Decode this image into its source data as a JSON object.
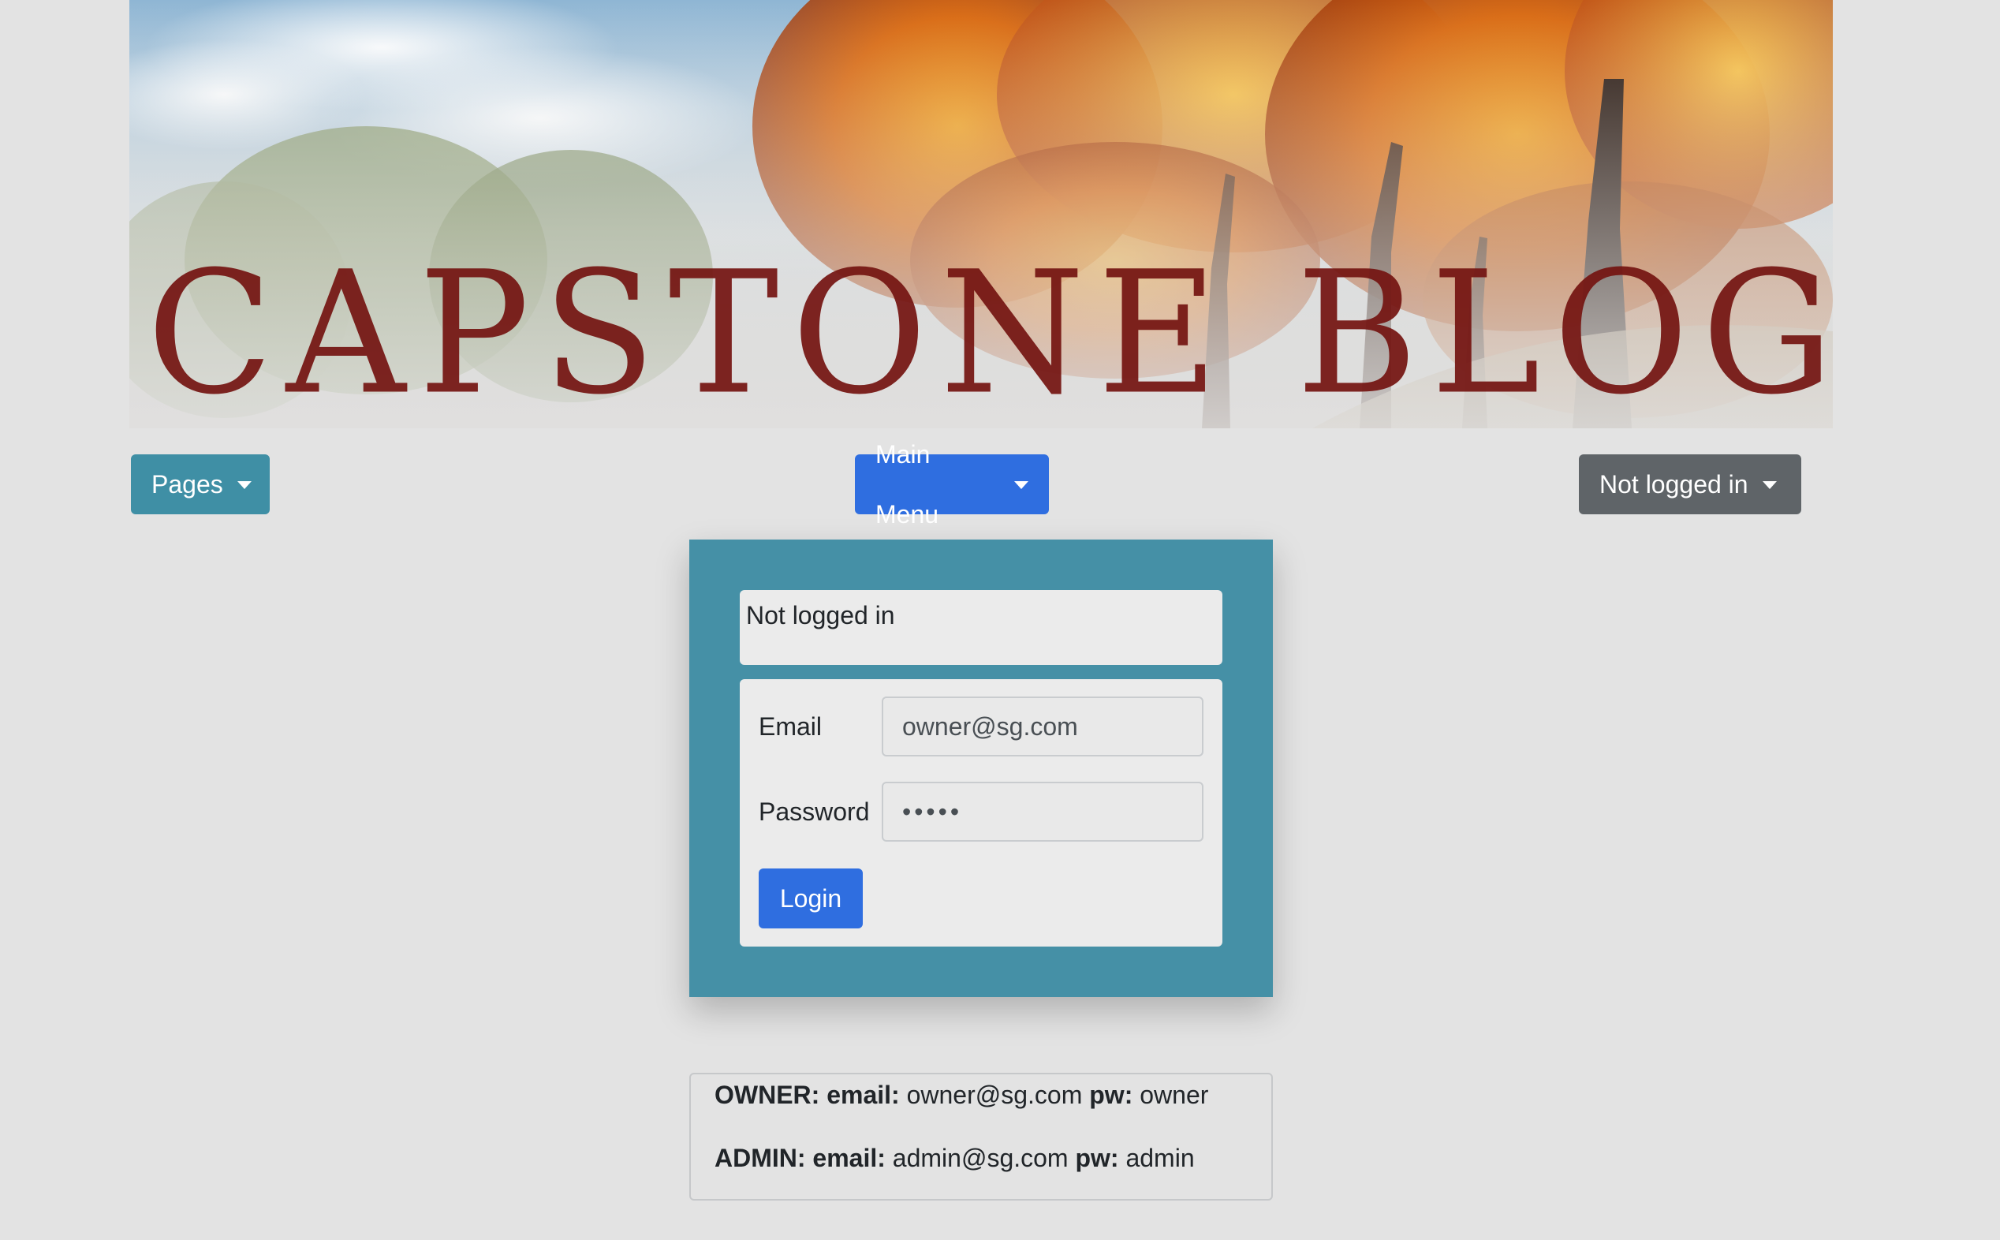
{
  "banner": {
    "title": "CAPSTONE BLOG"
  },
  "nav": {
    "pages_label": "Pages",
    "main_menu_label": "Main Menu",
    "user_menu_label": "Not logged in"
  },
  "login": {
    "status_text": "Not logged in",
    "email_label": "Email",
    "email_value": "owner@sg.com",
    "password_label": "Password",
    "password_value": "•••••",
    "login_button": "Login"
  },
  "credentials": {
    "owner": {
      "role": "OWNER:",
      "email_key": "email:",
      "email": "owner@sg.com",
      "pw_key": "pw:",
      "pw": "owner"
    },
    "admin": {
      "role": "ADMIN:",
      "email_key": "email:",
      "email": "admin@sg.com",
      "pw_key": "pw:",
      "pw": "admin"
    }
  },
  "colors": {
    "page_bg": "#e3e3e3",
    "pages_button": "#3f8fa5",
    "primary_button": "#2f6ee0",
    "secondary_button": "#5f6468",
    "panel": "#4590a6",
    "banner_title": "#741411"
  }
}
